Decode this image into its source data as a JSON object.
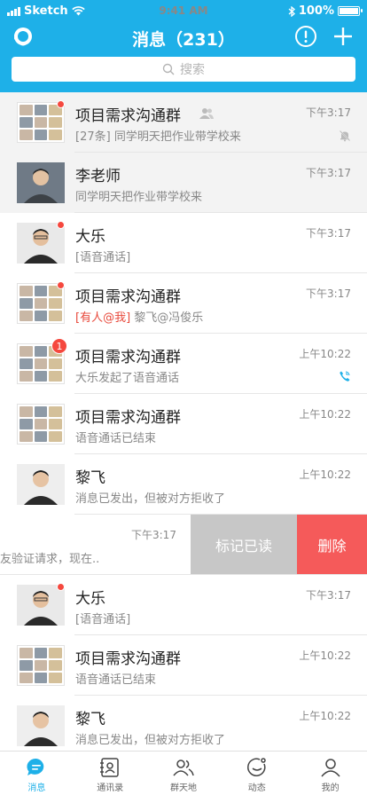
{
  "status_bar": {
    "carrier": "Sketch",
    "time": "9:41 AM",
    "battery": "100%"
  },
  "header": {
    "title": "消息（231）"
  },
  "search": {
    "placeholder": "搜索"
  },
  "conversations": [
    {
      "name": "项目需求沟通群",
      "message": "[27条] 同学明天把作业带学校来",
      "time": "下午3:17",
      "type": "group",
      "pinned": true,
      "muted": true,
      "dot": true
    },
    {
      "name": "李老师",
      "message": "同学明天把作业带学校来",
      "time": "下午3:17",
      "type": "person",
      "pinned": true
    },
    {
      "name": "大乐",
      "message": "[语音通话]",
      "time": "下午3:17",
      "type": "person",
      "dot": true
    },
    {
      "name": "项目需求沟通群",
      "message_mention": "[有人@我]",
      "message": " 黎飞@冯俊乐",
      "time": "下午3:17",
      "type": "group",
      "dot": true
    },
    {
      "name": "项目需求沟通群",
      "message": "大乐发起了语音通话",
      "time": "上午10:22",
      "type": "group",
      "badge": "1",
      "call": true
    },
    {
      "name": "项目需求沟通群",
      "message": "语音通话已结束",
      "time": "上午10:22",
      "type": "group"
    },
    {
      "name": "黎飞",
      "message": "消息已发出，但被对方拒收了",
      "time": "上午10:22",
      "type": "person"
    }
  ],
  "swiped_row": {
    "message": "友验证请求，现在..",
    "time": "下午3:17",
    "mark_read": "标记已读",
    "delete": "删除"
  },
  "conversations_after": [
    {
      "name": "大乐",
      "message": "[语音通话]",
      "time": "下午3:17",
      "type": "person",
      "dot": true
    },
    {
      "name": "项目需求沟通群",
      "message": "语音通话已结束",
      "time": "上午10:22",
      "type": "group"
    },
    {
      "name": "黎飞",
      "message": "消息已发出，但被对方拒收了",
      "time": "上午10:22",
      "type": "person"
    }
  ],
  "tabs": [
    {
      "label": "消息",
      "icon": "chat-icon",
      "active": true
    },
    {
      "label": "通讯录",
      "icon": "contacts-icon"
    },
    {
      "label": "群天地",
      "icon": "groups-icon"
    },
    {
      "label": "动态",
      "icon": "moments-icon"
    },
    {
      "label": "我的",
      "icon": "profile-icon"
    }
  ],
  "colors": {
    "primary": "#1EB0E8",
    "delete": "#F55A5A",
    "mark_read": "#C7C7C7",
    "badge": "#F5483E"
  }
}
